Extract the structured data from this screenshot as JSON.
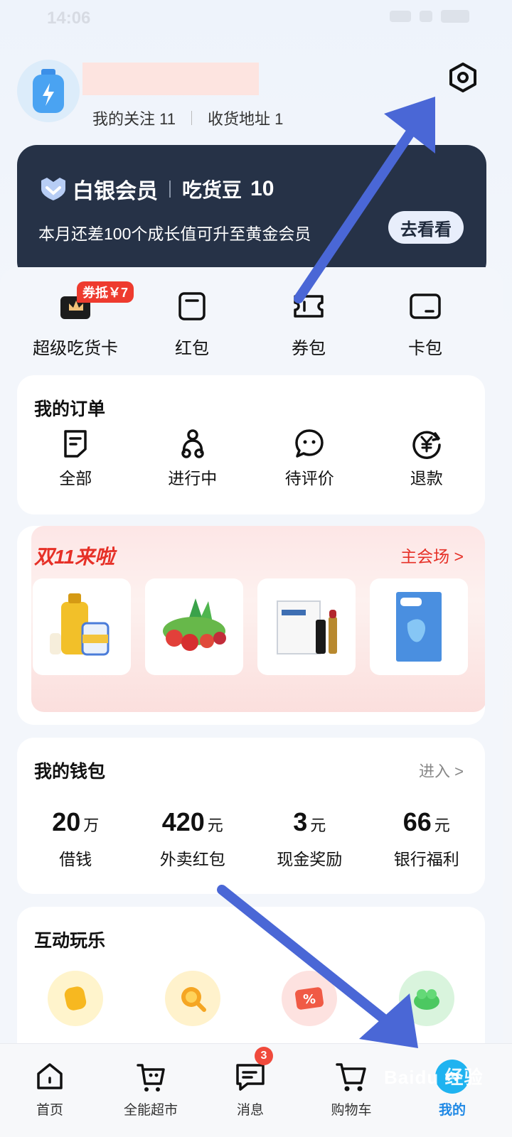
{
  "status_bar": {
    "time": "14:06"
  },
  "profile": {
    "follow_label": "我的关注 11",
    "address_label": "收货地址 1"
  },
  "vip": {
    "level": "白银会员",
    "bean_label": "吃货豆",
    "bean_count": "10",
    "subtitle": "本月还差100个成长值可升至黄金会员",
    "button": "去看看"
  },
  "quick_items": [
    {
      "label": "超级吃货卡",
      "icon": "super-card-icon",
      "badge": "券抵￥7"
    },
    {
      "label": "红包",
      "icon": "red-packet-icon"
    },
    {
      "label": "券包",
      "icon": "coupon-icon"
    },
    {
      "label": "卡包",
      "icon": "card-wallet-icon"
    }
  ],
  "orders": {
    "title": "我的订单",
    "items": [
      {
        "label": "全部",
        "icon": "order-list-icon"
      },
      {
        "label": "进行中",
        "icon": "scooter-icon"
      },
      {
        "label": "待评价",
        "icon": "comment-icon"
      },
      {
        "label": "退款",
        "icon": "refund-icon"
      }
    ]
  },
  "promo": {
    "title": "双11来啦",
    "more": "主会场 >"
  },
  "wallet": {
    "title": "我的钱包",
    "more": "进入 >",
    "items": [
      {
        "value": "20",
        "unit": "万",
        "label": "借钱"
      },
      {
        "value": "420",
        "unit": "元",
        "label": "外卖红包"
      },
      {
        "value": "3",
        "unit": "元",
        "label": "现金奖励"
      },
      {
        "value": "66",
        "unit": "元",
        "label": "银行福利"
      }
    ]
  },
  "fun": {
    "title": "互动玩乐"
  },
  "tabs": [
    {
      "label": "首页",
      "icon": "home-icon"
    },
    {
      "label": "全能超市",
      "icon": "basket-icon"
    },
    {
      "label": "消息",
      "icon": "message-icon",
      "badge": "3"
    },
    {
      "label": "购物车",
      "icon": "cart-icon"
    },
    {
      "label": "我的",
      "icon": "profile-icon",
      "active": true
    }
  ],
  "watermark": "Baidu 经验",
  "colors": {
    "accent": "#1e88e5",
    "vip_bg": "#263247",
    "promo_red": "#e63027",
    "arrow": "#4a67d6"
  }
}
